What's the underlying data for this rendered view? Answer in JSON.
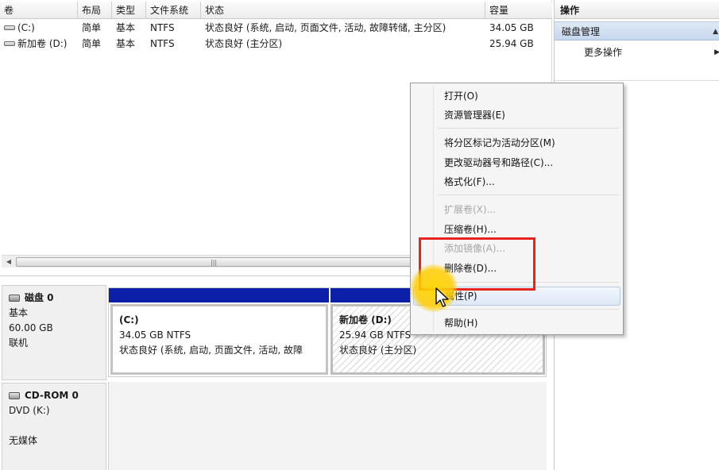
{
  "volume_table": {
    "columns": [
      "卷",
      "布局",
      "类型",
      "文件系统",
      "状态",
      "容量"
    ],
    "rows": [
      {
        "volume": "(C:)",
        "layout": "简单",
        "type": "基本",
        "fs": "NTFS",
        "status": "状态良好 (系统, 启动, 页面文件, 活动, 故障转储, 主分区)",
        "capacity": "34.05 GB"
      },
      {
        "volume": "新加卷 (D:)",
        "layout": "简单",
        "type": "基本",
        "fs": "NTFS",
        "status": "状态良好 (主分区)",
        "capacity": "25.94 GB"
      }
    ]
  },
  "actions": {
    "title": "操作",
    "section": "磁盘管理",
    "more": "更多操作"
  },
  "disks": [
    {
      "name": "磁盘 0",
      "type": "基本",
      "size": "60.00 GB",
      "state": "联机",
      "partitions": [
        {
          "name": "(C:)",
          "size_fs": "34.05 GB NTFS",
          "status": "状态良好 (系统, 启动, 页面文件, 活动, 故障"
        },
        {
          "name": "新加卷  (D:)",
          "size_fs": "25.94 GB NTFS",
          "status": "状态良好 (主分区)"
        }
      ]
    },
    {
      "name": "CD-ROM 0",
      "type": "DVD (K:)",
      "media": "无媒体"
    }
  ],
  "context_menu": {
    "items": [
      {
        "label": "打开(O)",
        "enabled": true
      },
      {
        "label": "资源管理器(E)",
        "enabled": true
      },
      {
        "label": "将分区标记为活动分区(M)",
        "enabled": true
      },
      {
        "label": "更改驱动器号和路径(C)...",
        "enabled": true
      },
      {
        "label": "格式化(F)...",
        "enabled": true
      },
      {
        "label": "扩展卷(X)...",
        "enabled": false
      },
      {
        "label": "压缩卷(H)...",
        "enabled": true
      },
      {
        "label": "添加镜像(A)...",
        "enabled": false
      },
      {
        "label": "删除卷(D)...",
        "enabled": true
      },
      {
        "label": "属性(P)",
        "enabled": true
      },
      {
        "label": "帮助(H)",
        "enabled": true
      }
    ]
  },
  "colors": {
    "primary_partition_bar": "#0b1fa8",
    "annotation_red": "#e8231f",
    "cursor_highlight": "#ffd400",
    "actions_section_bg": "#c6d7ee"
  },
  "icons": {
    "volume": "drive-icon",
    "disk": "hard-disk-icon",
    "cdrom": "cd-rom-icon",
    "section_caret": "caret-up-icon",
    "more_caret": "caret-right-icon",
    "scroll_left": "scroll-left-arrow-icon"
  }
}
